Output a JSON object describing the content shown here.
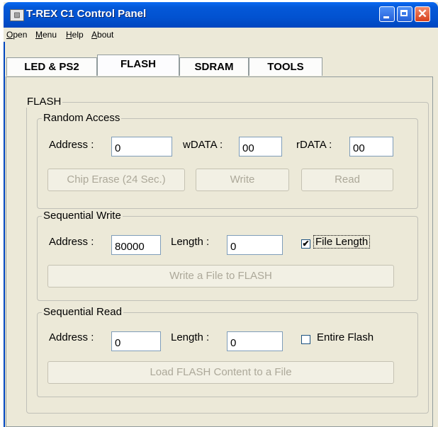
{
  "window": {
    "title": "T-REX C1 Control Panel",
    "app_icon": "app-icon"
  },
  "menubar": {
    "items": [
      "Open",
      "Menu",
      "Help",
      "About"
    ]
  },
  "tabs": [
    "LED & PS2",
    "FLASH",
    "SDRAM",
    "TOOLS"
  ],
  "active_tab": "FLASH",
  "flash": {
    "group_label": "FLASH",
    "random_access": {
      "label": "Random Access",
      "address_label": "Address :",
      "address_value": "0",
      "wdata_label": "wDATA :",
      "wdata_value": "00",
      "rdata_label": "rDATA :",
      "rdata_value": "00",
      "chip_erase_label": "Chip Erase (24 Sec.)",
      "write_label": "Write",
      "read_label": "Read"
    },
    "sequential_write": {
      "label": "Sequential Write",
      "address_label": "Address :",
      "address_value": "80000",
      "length_label": "Length :",
      "length_value": "0",
      "file_length_label": "File Length",
      "file_length_checked": true,
      "button_label": "Write a File to FLASH"
    },
    "sequential_read": {
      "label": "Sequential Read",
      "address_label": "Address :",
      "address_value": "0",
      "length_label": "Length :",
      "length_value": "0",
      "entire_flash_label": "Entire Flash",
      "entire_flash_checked": false,
      "button_label": "Load FLASH Content to a File"
    }
  }
}
